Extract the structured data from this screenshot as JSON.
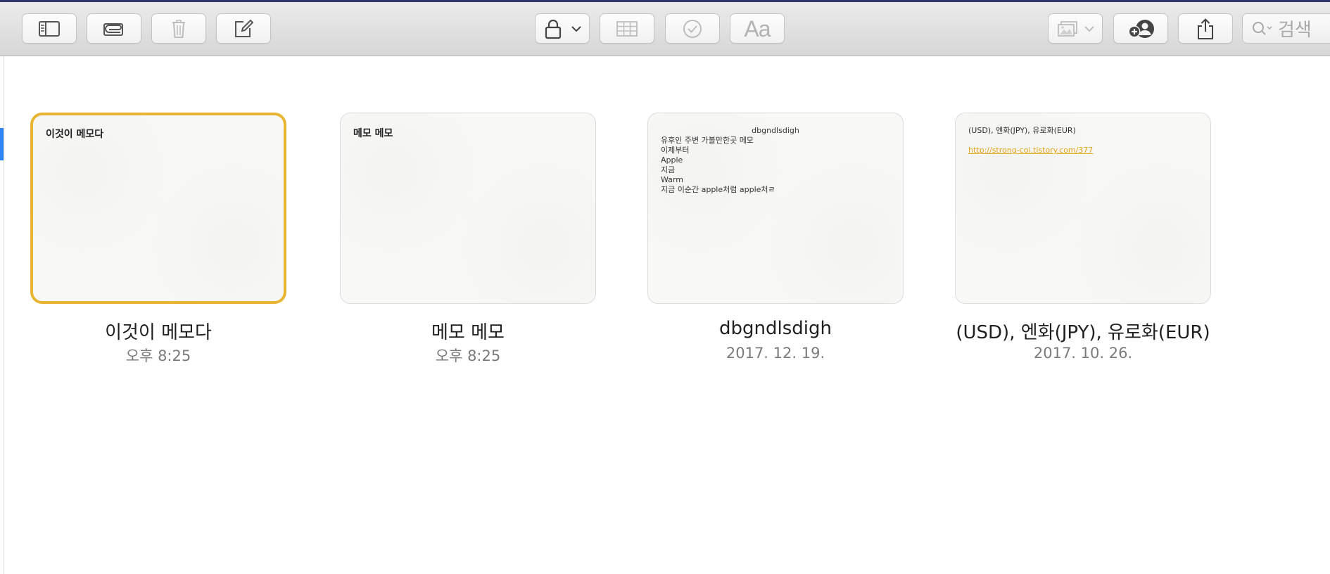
{
  "toolbar": {
    "buttons": [
      {
        "name": "sidebar-toggle-button",
        "icon": "sidebar-icon"
      },
      {
        "name": "attachments-button",
        "icon": "paperclip-icon"
      },
      {
        "name": "delete-button",
        "icon": "trash-icon"
      },
      {
        "name": "compose-button",
        "icon": "compose-icon"
      },
      {
        "name": "lock-button",
        "icon": "lock-icon"
      },
      {
        "name": "table-button",
        "icon": "table-icon"
      },
      {
        "name": "checklist-button",
        "icon": "checkmark-circle-icon"
      },
      {
        "name": "format-button",
        "icon": "text-format-icon",
        "label": "Aa"
      },
      {
        "name": "media-button",
        "icon": "photo-icon"
      },
      {
        "name": "add-people-button",
        "icon": "add-person-icon"
      },
      {
        "name": "share-button",
        "icon": "share-icon"
      }
    ],
    "format_label": "Aa",
    "search": {
      "placeholder": "검색",
      "icon": "search-icon"
    }
  },
  "notes": [
    {
      "title": "이것이 메모다",
      "date": "오후 8:25",
      "selected": true,
      "preview_title": "이것이 메모다",
      "preview_lines": []
    },
    {
      "title": "메모 메모",
      "date": "오후 8:25",
      "selected": false,
      "preview_title": "메모 메모",
      "preview_lines": []
    },
    {
      "title": "dbgndlsdigh",
      "date": "2017. 12. 19.",
      "selected": false,
      "preview_heading": "dbgndlsdigh",
      "preview_lines": [
        "유후인 주변 가볼만한곳 메모",
        "이제부터",
        "Apple",
        "지금",
        "Warm",
        "지금 이순간 apple처럼 apple처ㄹ"
      ]
    },
    {
      "title": "(USD), 엔화(JPY), 유로화(EUR)",
      "date": "2017. 10. 26.",
      "selected": false,
      "preview_lines": [
        "(USD), 엔화(JPY), 유로화(EUR)"
      ],
      "preview_link": "http://strong-coi.tistory.com/377"
    }
  ],
  "colors": {
    "accent": "#e8b532",
    "link": "#e0a418",
    "selection_bar": "#2f84f5"
  }
}
